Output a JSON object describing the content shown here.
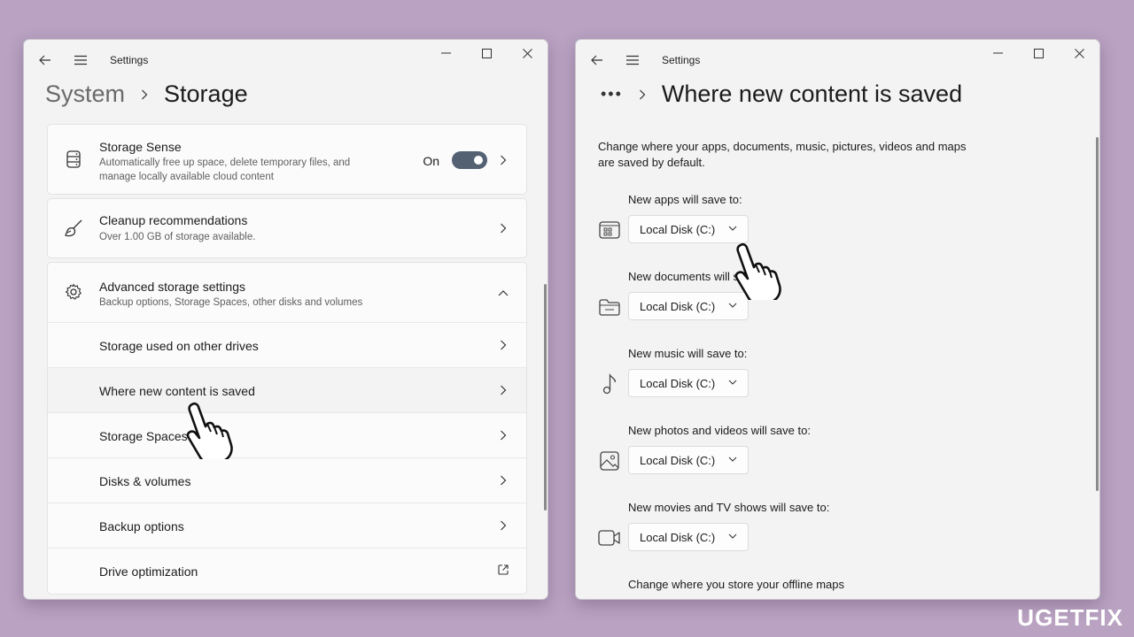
{
  "left_window": {
    "title": "Settings",
    "breadcrumb": {
      "parent": "System",
      "current": "Storage"
    },
    "storage_sense": {
      "title": "Storage Sense",
      "subtitle_line1": "Automatically free up space, delete temporary files, and",
      "subtitle_line2": "manage locally available cloud content",
      "toggle_label": "On",
      "toggle_on": true
    },
    "cleanup": {
      "title": "Cleanup recommendations",
      "subtitle": "Over 1.00 GB of storage available."
    },
    "advanced": {
      "title": "Advanced storage settings",
      "subtitle": "Backup options, Storage Spaces, other disks and volumes",
      "items": [
        {
          "label": "Storage used on other drives"
        },
        {
          "label": "Where new content is saved"
        },
        {
          "label": "Storage Spaces"
        },
        {
          "label": "Disks & volumes"
        },
        {
          "label": "Backup options"
        },
        {
          "label": "Drive optimization"
        }
      ]
    }
  },
  "right_window": {
    "title": "Settings",
    "breadcrumb": {
      "ellipsis": "•••",
      "current": "Where new content is saved"
    },
    "description_line1": "Change where your apps, documents, music, pictures, videos and maps",
    "description_line2": "are saved by default.",
    "sections": [
      {
        "label": "New apps will save to:",
        "value": "Local Disk (C:)",
        "icon": "apps-icon"
      },
      {
        "label": "New documents will save to:",
        "value": "Local Disk (C:)",
        "icon": "folder-icon"
      },
      {
        "label": "New music will save to:",
        "value": "Local Disk (C:)",
        "icon": "music-icon"
      },
      {
        "label": "New photos and videos will save to:",
        "value": "Local Disk (C:)",
        "icon": "photo-icon"
      },
      {
        "label": "New movies and TV shows will save to:",
        "value": "Local Disk (C:)",
        "icon": "video-icon"
      }
    ],
    "offline_maps_label": "Change where you store your offline maps"
  },
  "watermark": {
    "text_a": "U",
    "text_b": "G",
    "text_c": "ET",
    "text_d": "FIX"
  },
  "colors": {
    "background": "#b9a2c2",
    "window": "#f3f3f3",
    "toggle": "#536173"
  }
}
